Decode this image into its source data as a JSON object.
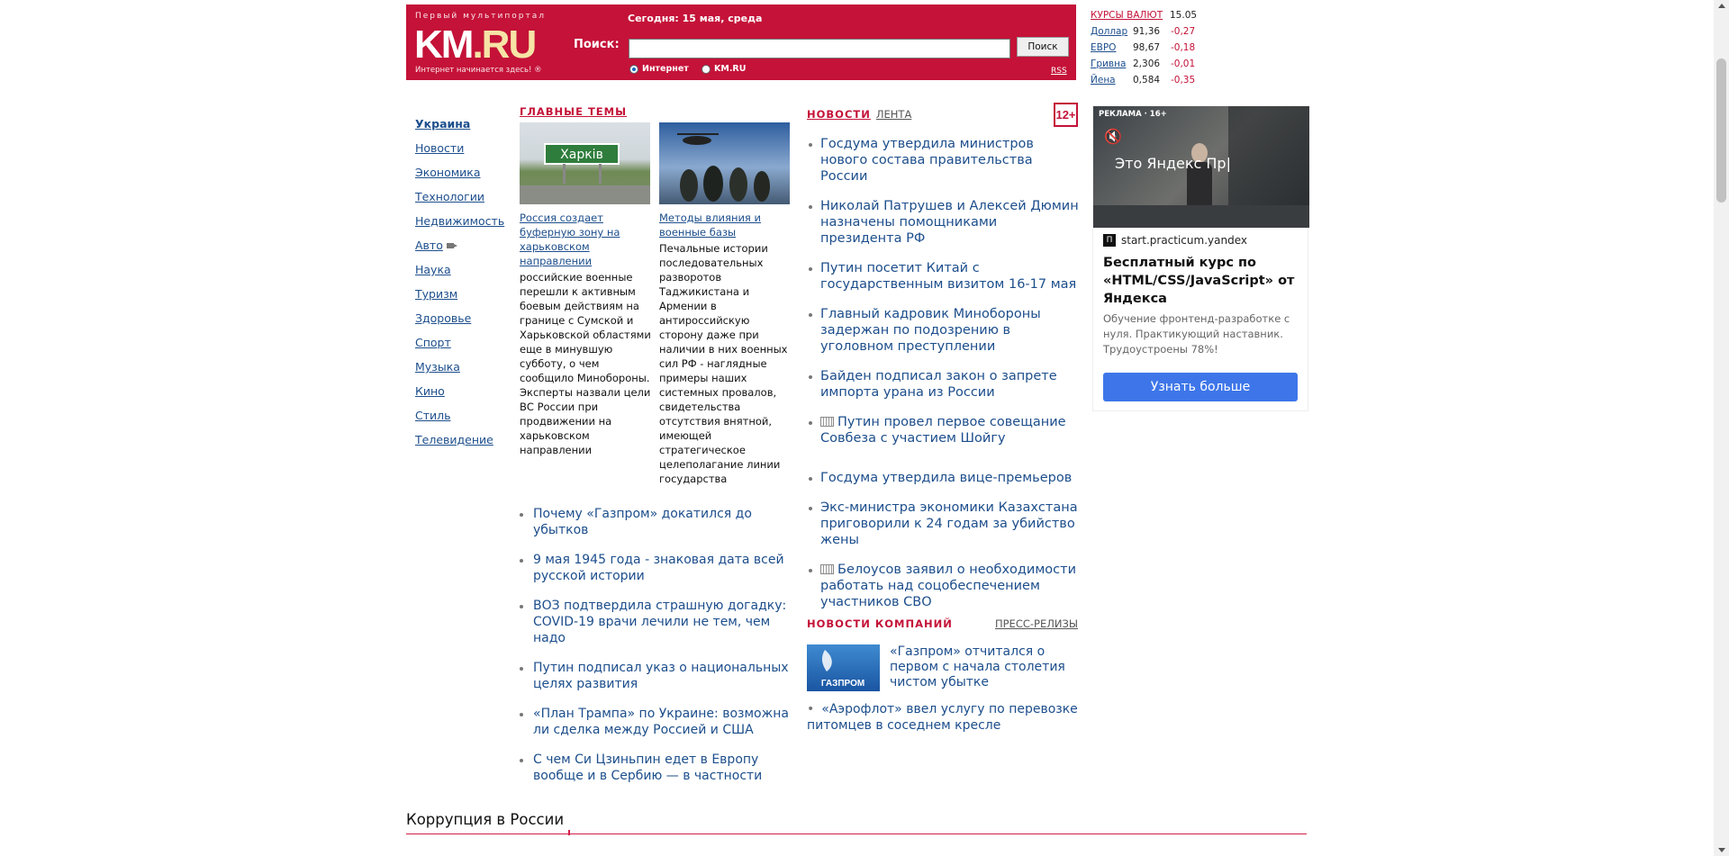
{
  "header": {
    "slogan": "Первый мультипортал",
    "logo_main": "KM",
    "logo_tld": ".RU",
    "tagline": "Интернет начинается здесь! ®",
    "date": "Сегодня: 15 мая, среда",
    "search_label": "Поиск:",
    "search_value": "",
    "search_button": "Поиск",
    "radio_internet": "Интернет",
    "radio_kmru": "KM.RU",
    "rss": "RSS"
  },
  "rates": {
    "title": "КУРСЫ ВАЛЮТ",
    "date": "15.05",
    "items": [
      {
        "name": "Доллар",
        "value": "91,36",
        "change": "-0,27"
      },
      {
        "name": "ЕВРО",
        "value": "98,67",
        "change": "-0,18"
      },
      {
        "name": "Гривна",
        "value": "2,306",
        "change": "-0,01"
      },
      {
        "name": "Йена",
        "value": "0,584",
        "change": "-0,35"
      }
    ]
  },
  "nav": [
    "Украина",
    "Новости",
    "Экономика",
    "Технологии",
    "Недвижимость",
    "Авто",
    "Наука",
    "Туризм",
    "Здоровье",
    "Спорт",
    "Музыка",
    "Кино",
    "Стиль",
    "Телевидение"
  ],
  "main_themes": {
    "title": "ГЛАВНЫЕ ТЕМЫ",
    "cards": [
      {
        "sign": "Харків",
        "caption": "Россия создает буферную зону на харьковском направлении",
        "text": "российские военные перешли к активным боевым действиям на границе с Сумской и Харьковской областями еще в минувшую субботу, о чем сообщило Минобороны. Эксперты назвали цели ВС России при продвижении на харьковском направлении"
      },
      {
        "sign": "",
        "caption": "Методы влияния и военные базы",
        "text": "Печальные истории последовательных разворотов Таджикистана и Армении в антироссийскую сторону даже при наличии в них военных сил РФ - наглядные примеры наших системных провалов, свидетельства отсутствия внятной, имеющей стратегическое целеполагание линии государства"
      }
    ],
    "list": [
      "Почему «Газпром» докатился до убытков",
      "9 мая 1945 года - знаковая дата всей русской истории",
      "ВОЗ подтвердила страшную догадку: COVID-19 врачи лечили не тем, чем надо",
      "Путин подписал указ о национальных целях развития",
      "«План Трампа» по Украине: возможна ли сделка между Россией и США",
      "С чем Си Цзиньпин едет в Европу вообще и в Сербию — в частности"
    ]
  },
  "news": {
    "tab_news": "НОВОСТИ",
    "tab_feed": "ЛЕНТА",
    "age": "12+",
    "items": [
      "Госдума утвердила министров нового состава правительства России",
      "Николай Патрушев и Алексей Дюмин назначены помощниками президента РФ",
      "Путин посетит Китай с государственным визитом 16-17 мая",
      "Главный кадровик Минобороны задержан по подозрению в уголовном преступлении",
      "Байден подписал закон о запрете импорта урана из России",
      "Путин провел первое совещание Совбеза с участием Шойгу",
      "Госдума утвердила вице-премьеров",
      "Экс-министра экономики Казахстана приговорили к 24 годам за убийство жены",
      "Белоусов заявил о необходимости работать над соцобеспечением участников СВО"
    ],
    "company_title": "НОВОСТИ КОМПАНИЙ",
    "press_link": "ПРЕСС-РЕЛИЗЫ",
    "gazprom_logo": "ГАЗПРОМ",
    "company_1": "«Газпром» отчитался о первом с начала столетия чистом убытке",
    "company_2": "«Аэрофлот» ввел услугу по перевозке питомцев в соседнем кресле"
  },
  "ad": {
    "label": "РЕКЛАМА · 16+",
    "video_text": "Это Яндекс Пр|",
    "domain": "start.practicum.yandex",
    "domain_icon": "П",
    "headline": "Бесплатный курс по «HTML/CSS/JavaScript» от Яндекса",
    "description": "Обучение фронтенд-разработке с нуля. Практикующий наставник. Трудоустроены 78%!",
    "button": "Узнать больше"
  },
  "bottom": {
    "section_title": "Коррупция в России"
  }
}
